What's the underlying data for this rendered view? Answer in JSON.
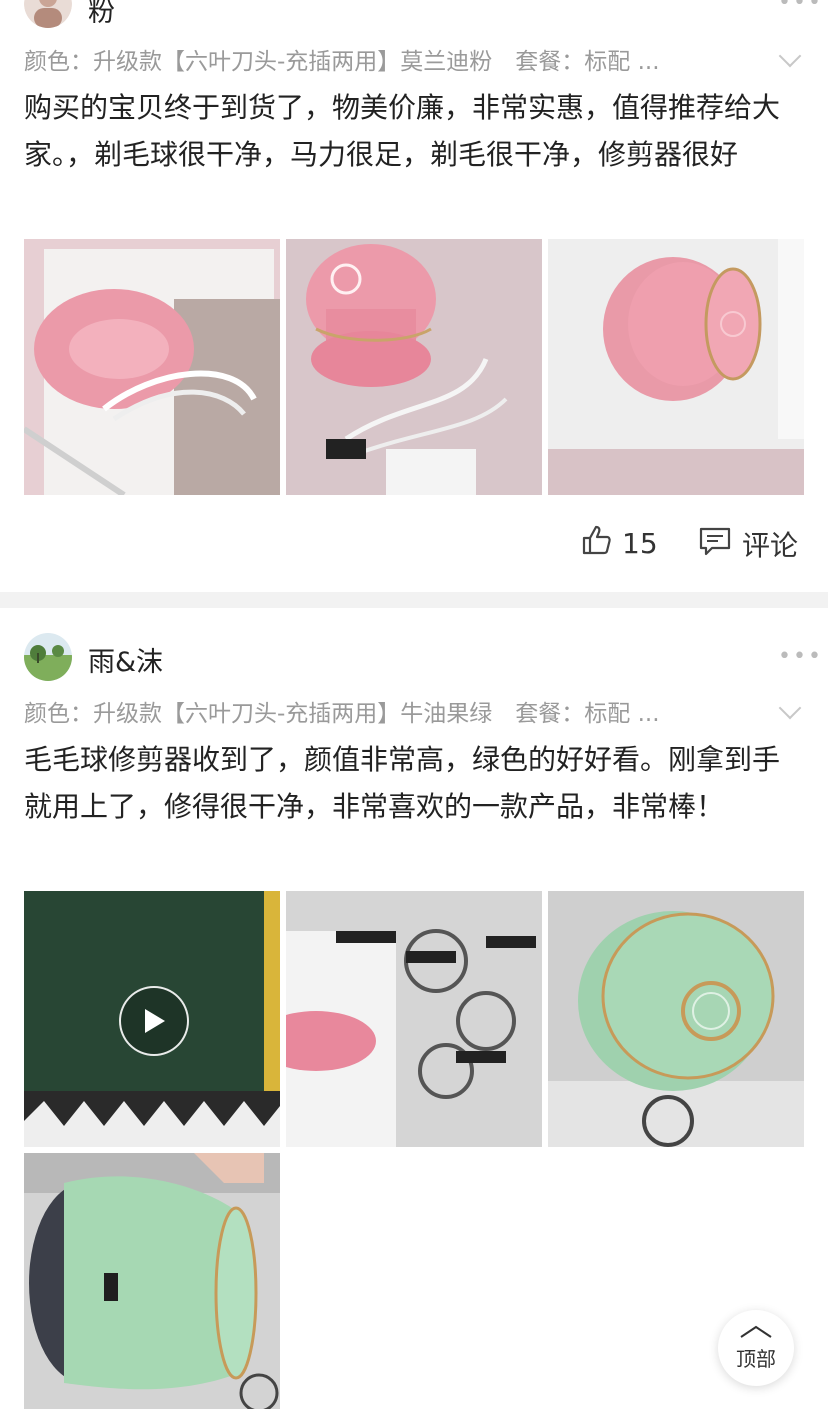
{
  "review1": {
    "username": "粉",
    "sku": "颜色：升级款【六叶刀头-充插两用】莫兰迪粉　套餐：标配 ...",
    "content": "购买的宝贝终于到货了，物美价廉，非常实惠，值得推荐给大家。，剃毛球很干净，马力很足，剃毛很干净，修剪器很好",
    "likes": "15",
    "comment_label": "评论"
  },
  "review2": {
    "username": "雨&沫",
    "sku": "颜色：升级款【六叶刀头-充插两用】牛油果绿　套餐：标配 ...",
    "content": "毛毛球修剪器收到了，颜值非常高，绿色的好好看。刚拿到手就用上了，修得很干净，非常喜欢的一款产品，非常棒！"
  },
  "back_to_top": "顶部",
  "icons": {
    "more": "more-dots-icon",
    "expand": "chevron-down-icon",
    "like": "thumbs-up-icon",
    "comment": "comment-icon",
    "play": "play-icon",
    "top": "chevron-up-icon"
  },
  "colors": {
    "pink_product": "#eb9aa9",
    "green_product": "#a9d8b6",
    "divider": "#f2f2f2",
    "secondary_text": "#9a9a9a"
  }
}
